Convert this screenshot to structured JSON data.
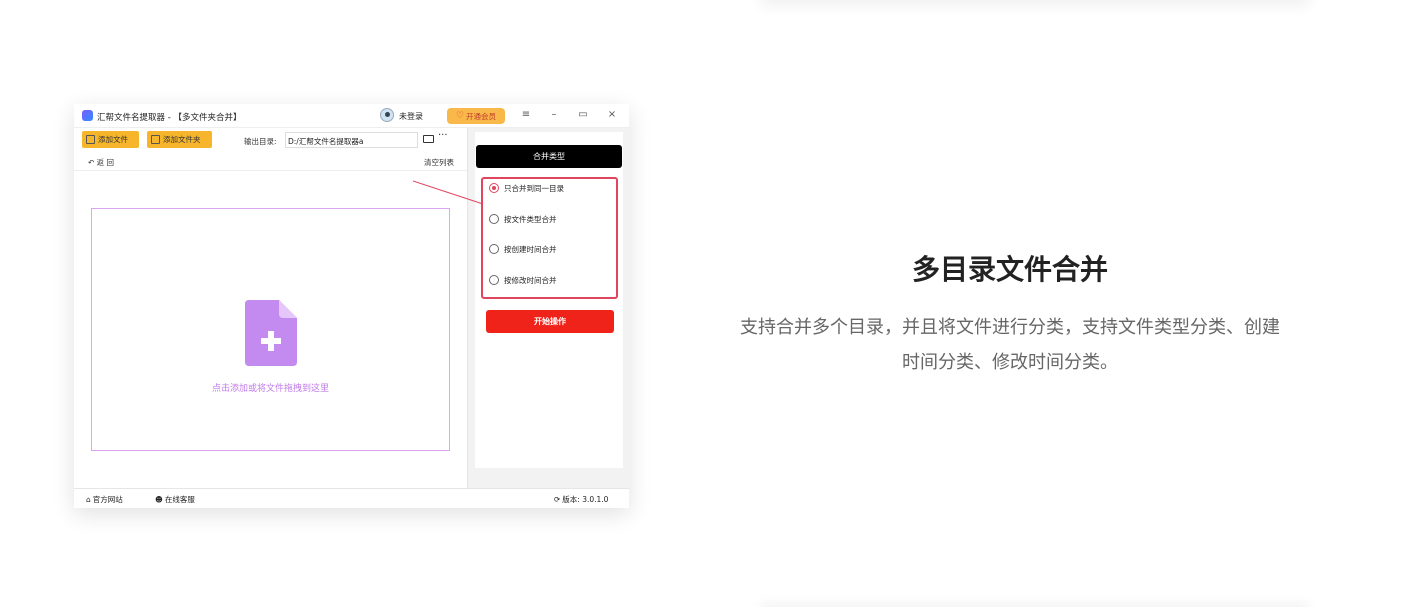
{
  "app": {
    "title": "汇帮文件名提取器 - 【多文件夹合并】",
    "login_text": "未登录",
    "vip_label": "开通会员",
    "window_controls": {
      "menu": "≡",
      "minimize": "–",
      "maximize": "▭",
      "close": "×"
    },
    "toolbar": {
      "add_file": "添加文件",
      "add_folder": "添加文件夹",
      "output_label": "输出目录:",
      "output_path": "D:/汇帮文件名提取器a",
      "more": "···"
    },
    "back_label": "返 回",
    "clear_list": "清空列表",
    "drop_text": "点击添加或将文件拖拽到这里",
    "merge_type_title": "合并类型",
    "options": [
      {
        "label": "只合并到同一目录",
        "selected": true
      },
      {
        "label": "按文件类型合并",
        "selected": false
      },
      {
        "label": "按创建时间合并",
        "selected": false
      },
      {
        "label": "按修改时间合并",
        "selected": false
      }
    ],
    "start_button": "开始操作",
    "statusbar": {
      "website": "官方网站",
      "support": "在线客服",
      "version": "版本: 3.0.1.0"
    }
  },
  "feature": {
    "title": "多目录文件合并",
    "description_line1": "支持合并多个目录，并且将文件进行分类，支持文件类型分类、创建",
    "description_line2": "时间分类、修改时间分类。"
  },
  "colors": {
    "accent_yellow": "#f6b52a",
    "option_highlight": "#e0455d",
    "start_red": "#ef231a",
    "drop_purple": "#c07be8",
    "file_icon_purple": "#c38af0"
  }
}
